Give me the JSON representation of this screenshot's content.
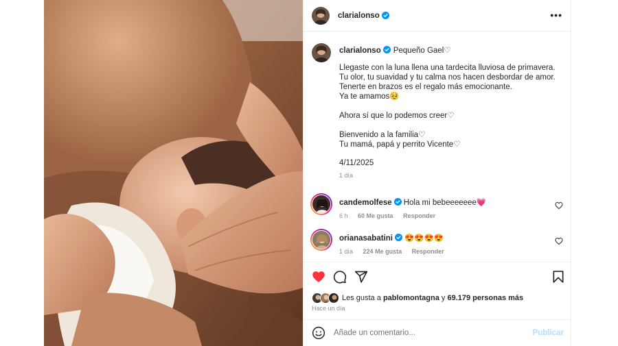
{
  "post": {
    "author": "clarialonso",
    "verified": true,
    "caption_title": "Pequeño Gael♡",
    "caption_text": "Llegaste con la luna llena una tardecita lluviosa de primavera.\nTu olor, tu suavidad y tu calma nos hacen desbordar de amor.\nTenerte en brazos es el regalo más emocionante.\nYa te amamos🥹\n\nAhora sí que lo podemos creer♡\n\nBienvenido a la familia♡\nTu mamá, papá y perrito Vicente♡",
    "date": "4/11/2025",
    "time_ago": "1 día"
  },
  "comments": [
    {
      "user": "candemolfese",
      "verified": true,
      "text": "Hola mi bebeeeeeee💗",
      "time": "6 h",
      "likes": "60 Me gusta",
      "reply": "Responder"
    },
    {
      "user": "orianasabatini",
      "verified": true,
      "text": "😍😍😍😍",
      "time": "1 día",
      "likes": "224 Me gusta",
      "reply": "Responder"
    }
  ],
  "likes_summary": {
    "prefix": "Les gusta a",
    "user": "pablomontagna",
    "connector": "y",
    "others": "69.179 personas más"
  },
  "since": "Hace un día",
  "add_comment": {
    "placeholder": "Añade un comentario...",
    "publish_label": "Publicar"
  },
  "icons": {
    "more": "more-options-icon",
    "like": "heart-filled-icon",
    "comment": "comment-icon",
    "share": "share-icon",
    "save": "bookmark-icon",
    "emoji": "emoji-icon",
    "verified": "verified-badge-icon"
  },
  "colors": {
    "like_red": "#ff3040",
    "verified_blue": "#0095f6",
    "publish_disabled": "#b2dffc",
    "meta_gray": "#8e8e8e"
  }
}
